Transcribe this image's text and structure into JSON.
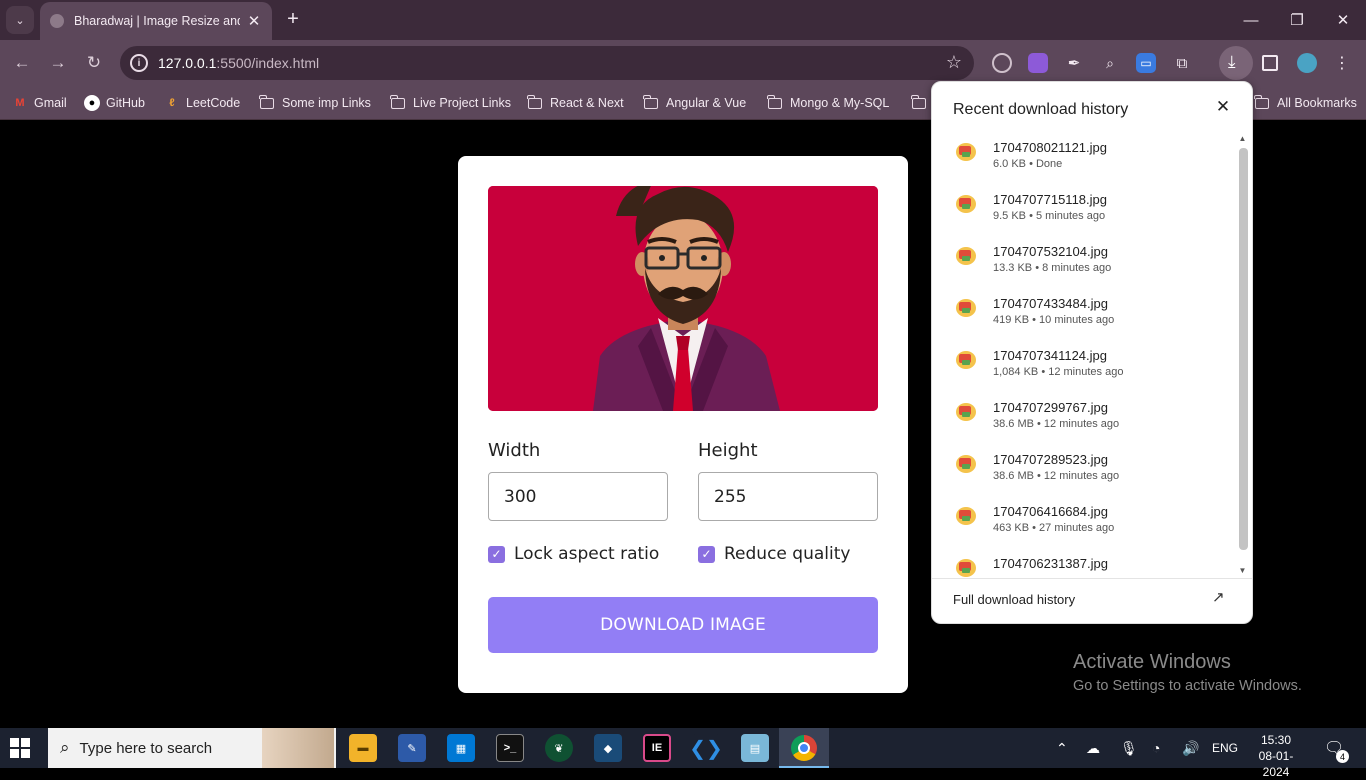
{
  "browser": {
    "tab_title": "Bharadwaj | Image Resize and C",
    "url_host": "127.0.0.1",
    "url_path": ":5500/index.html",
    "bookmarks": [
      {
        "label": "Gmail",
        "icon": "gmail-icon"
      },
      {
        "label": "GitHub",
        "icon": "github-icon"
      },
      {
        "label": "LeetCode",
        "icon": "leetcode-icon"
      },
      {
        "label": "Some imp Links",
        "icon": "folder-icon"
      },
      {
        "label": "Live Project Links",
        "icon": "folder-icon"
      },
      {
        "label": "React & Next",
        "icon": "folder-icon"
      },
      {
        "label": "Angular & Vue",
        "icon": "folder-icon"
      },
      {
        "label": "Mongo & My-SQL",
        "icon": "folder-icon"
      }
    ],
    "all_bookmarks": "All Bookmarks"
  },
  "app": {
    "width_label": "Width",
    "width_value": "300",
    "height_label": "Height",
    "height_value": "255",
    "lock_aspect_label": "Lock aspect ratio",
    "lock_aspect_checked": true,
    "reduce_quality_label": "Reduce quality",
    "reduce_quality_checked": true,
    "download_button": "DOWNLOAD IMAGE"
  },
  "downloads": {
    "title": "Recent download history",
    "items": [
      {
        "name": "1704708021121.jpg",
        "meta": "6.0 KB • Done"
      },
      {
        "name": "1704707715118.jpg",
        "meta": "9.5 KB • 5 minutes ago"
      },
      {
        "name": "1704707532104.jpg",
        "meta": "13.3 KB • 8 minutes ago"
      },
      {
        "name": "1704707433484.jpg",
        "meta": "419 KB • 10 minutes ago"
      },
      {
        "name": "1704707341124.jpg",
        "meta": "1,084 KB • 12 minutes ago"
      },
      {
        "name": "1704707299767.jpg",
        "meta": "38.6 MB • 12 minutes ago"
      },
      {
        "name": "1704707289523.jpg",
        "meta": "38.6 MB • 12 minutes ago"
      },
      {
        "name": "1704706416684.jpg",
        "meta": "463 KB • 27 minutes ago"
      },
      {
        "name": "1704706231387.jpg",
        "meta": ""
      }
    ],
    "footer": "Full download history"
  },
  "watermark": {
    "line1": "Activate Windows",
    "line2": "Go to Settings to activate Windows."
  },
  "taskbar": {
    "search_placeholder": "Type here to search",
    "language": "ENG",
    "time": "15:30",
    "date": "08-01-2024",
    "notification_count": "4"
  }
}
